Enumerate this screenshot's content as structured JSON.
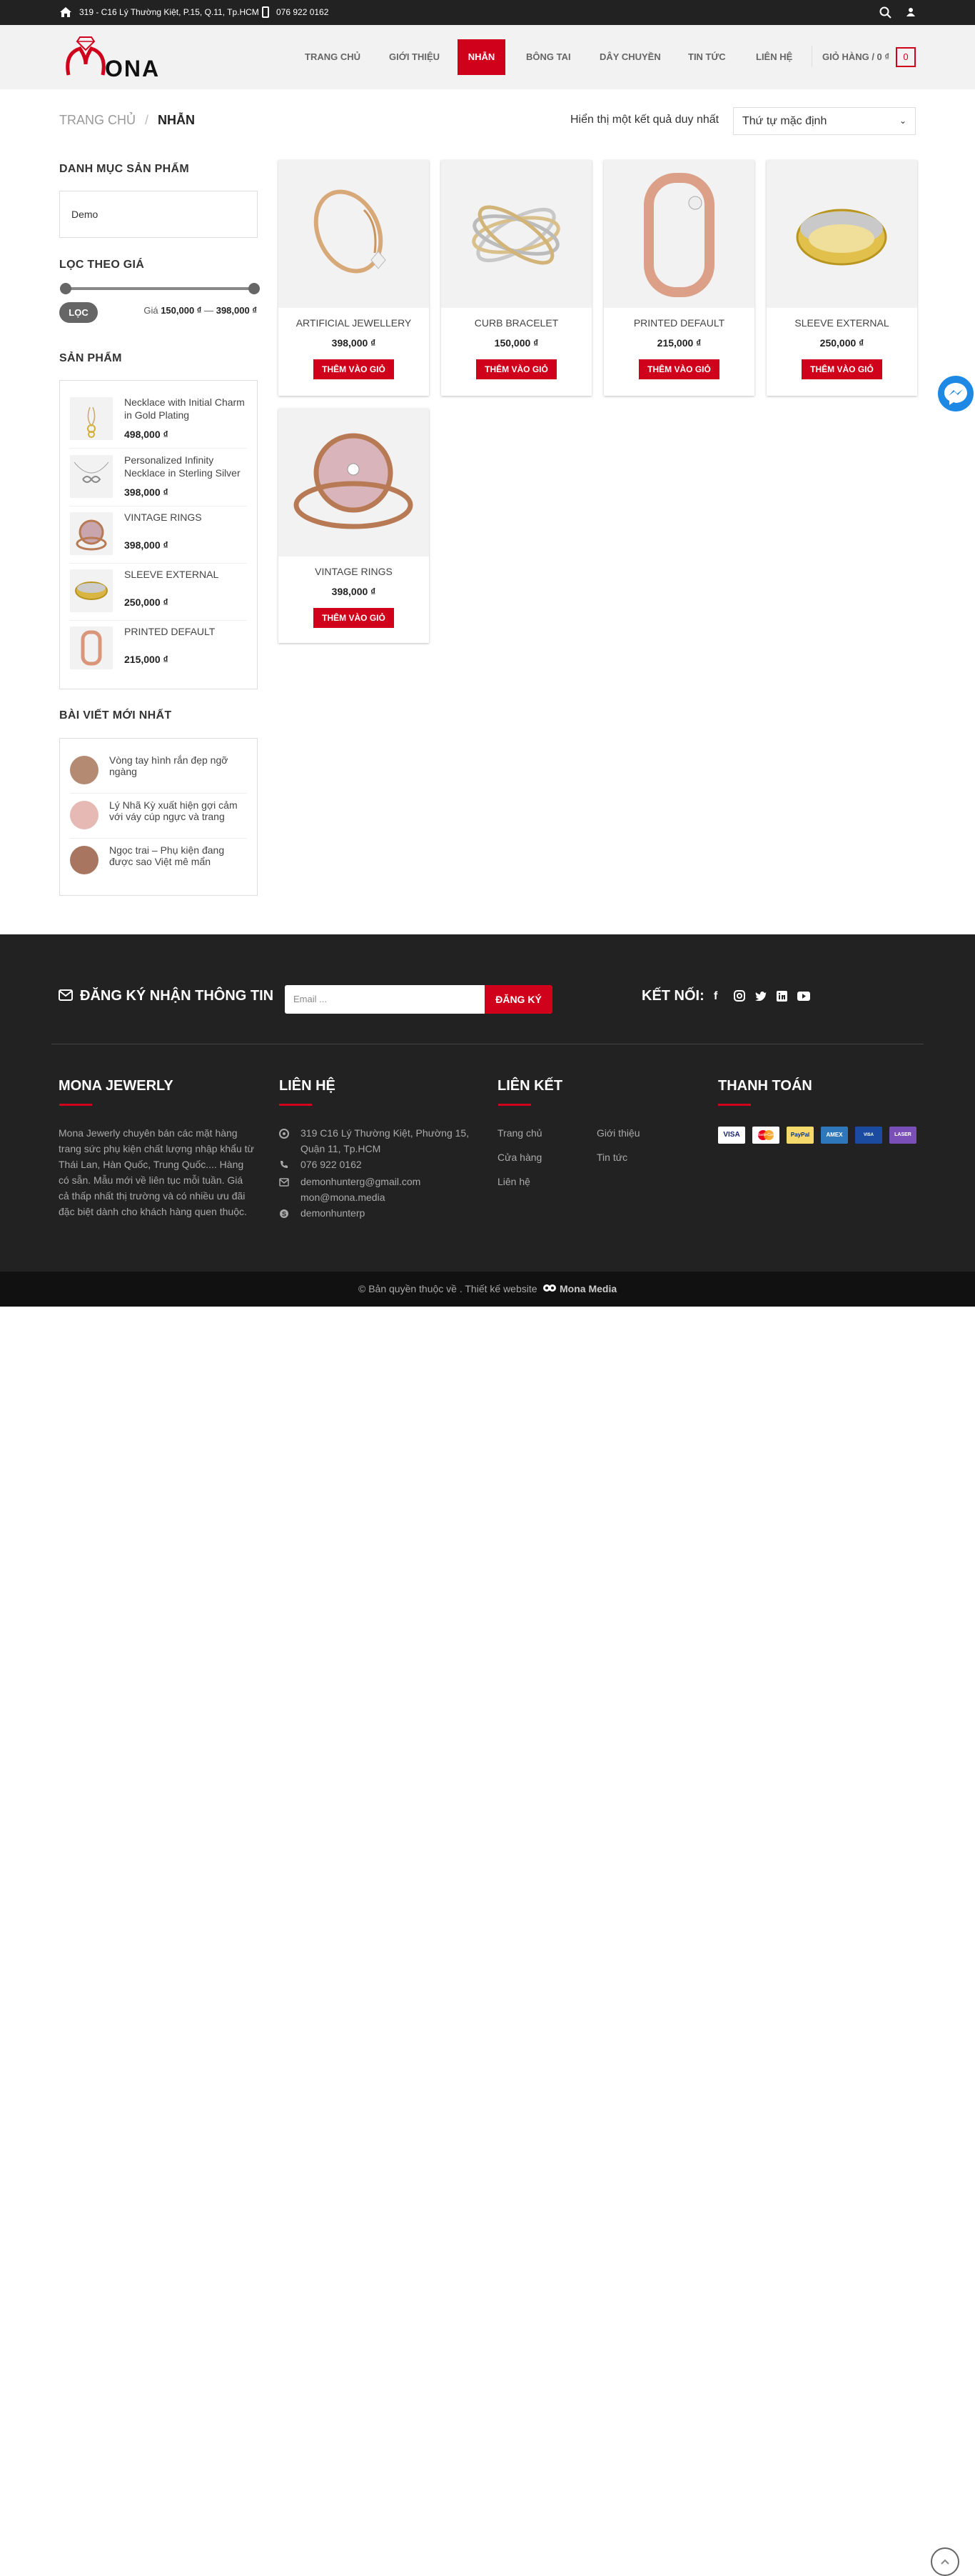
{
  "topbar": {
    "address": "319 - C16 Lý Thường Kiệt, P.15, Q.11, Tp.HCM",
    "phone": "076 922 0162"
  },
  "logo": {
    "text": "ONA"
  },
  "nav": {
    "items": [
      "Trang chủ",
      "Giới thiệu",
      "Nhẫn",
      "Bông tai",
      "Dây chuyền",
      "Tin tức",
      "Liên hệ"
    ],
    "active": "Nhẫn",
    "cart_label": "Giỏ hàng / 0 ₫",
    "cart_count": "0"
  },
  "breadcrumb": {
    "home": "Trang chủ",
    "sep": "/",
    "current": "Nhẫn"
  },
  "result_text": "Hiển thị một kết quả duy nhất",
  "sort": {
    "selected": "Thứ tự mặc định"
  },
  "sidebar": {
    "categories_title": "Danh mục sản phẩm",
    "category_demo": "Demo",
    "price_title": "Lọc theo giá",
    "filter_button": "Lọc",
    "price_label": "Giá",
    "price_min": "150,000 ₫",
    "price_dash": "—",
    "price_max": "398,000 ₫",
    "products_title": "Sản phẩm",
    "products": [
      {
        "name": "Necklace with Initial Charm in Gold Plating",
        "price": "498,000 ₫"
      },
      {
        "name": "Personalized Infinity Necklace in Sterling Silver",
        "price": "398,000 ₫"
      },
      {
        "name": "VINTAGE RINGS",
        "price": "398,000 ₫"
      },
      {
        "name": "SLEEVE EXTERNAL",
        "price": "250,000 ₫"
      },
      {
        "name": "PRINTED DEFAULT",
        "price": "215,000 ₫"
      }
    ],
    "posts_title": "Bài viết mới nhất",
    "posts": [
      {
        "title": "Vòng tay hình rắn đẹp ngỡ ngàng"
      },
      {
        "title": "Lý Nhã Kỳ xuất hiện gợi cảm với váy cúp ngực và trang sức..."
      },
      {
        "title": "Ngọc trai – Phụ kiện đang được sao Việt mê mẩn những..."
      }
    ]
  },
  "products": [
    {
      "name": "ARTIFICIAL JEWELLERY",
      "price": "398,000 ₫",
      "button": "Thêm vào giỏ"
    },
    {
      "name": "CURB BRACELET",
      "price": "150,000 ₫",
      "button": "Thêm vào giỏ"
    },
    {
      "name": "PRINTED DEFAULT",
      "price": "215,000 ₫",
      "button": "Thêm vào giỏ"
    },
    {
      "name": "SLEEVE EXTERNAL",
      "price": "250,000 ₫",
      "button": "Thêm vào giỏ"
    },
    {
      "name": "VINTAGE RINGS",
      "price": "398,000 ₫",
      "button": "Thêm vào giỏ"
    }
  ],
  "footer": {
    "newsletter_title": "Đăng ký nhận thông tin",
    "email_placeholder": "Email ...",
    "register_button": "Đăng ký",
    "connect_title": "Kết nối:",
    "about_title": "Mona Jewerly",
    "about_text": "Mona Jewerly chuyên bán các mặt hàng trang sức phụ kiện chất lượng nhập khẩu từ Thái Lan, Hàn Quốc, Trung Quốc.... Hàng có sẵn. Mẫu mới về liên tục mỗi tuần. Giá cả thấp nhất thị trường và có nhiều ưu đãi đặc biệt dành cho khách hàng quen thuộc.",
    "contact_title": "Liên hệ",
    "contact_address": "319 C16 Lý Thường Kiệt, Phường 15, Quận 11, Tp.HCM",
    "contact_phone": "076 922 0162",
    "contact_email1": "demonhunterg@gmail.com",
    "contact_email2": "mon@mona.media",
    "contact_skype": "demonhunterp",
    "links_title": "Liên kết",
    "links": [
      "Trang chủ",
      "Giới thiệu",
      "Cửa hàng",
      "Tin tức",
      "Liên hệ"
    ],
    "payment_title": "Thanh toán",
    "payments": [
      "VISA",
      "MasterCard",
      "PayPal",
      "AMEX",
      "VISA Electron",
      "LASER"
    ],
    "copyright_prefix": "© Bản quyền thuộc về . Thiết kế website",
    "copyright_brand": "Mona Media"
  },
  "colors": {
    "accent": "#d0011b",
    "topbar": "#222222",
    "footer": "#222222"
  }
}
